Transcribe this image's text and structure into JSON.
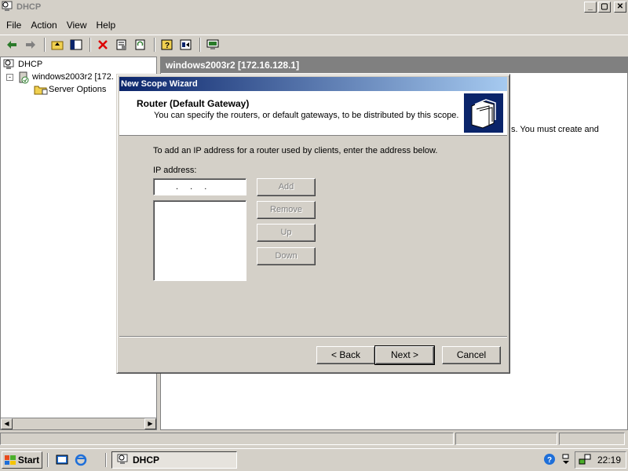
{
  "app": {
    "title": "DHCP",
    "min_btn": "_",
    "max_btn": "▢",
    "close_btn": "✕"
  },
  "menu": {
    "file": "File",
    "action": "Action",
    "view": "View",
    "help": "Help"
  },
  "toolbar": {
    "icons": [
      "back-arrow-icon",
      "forward-arrow-icon",
      "up-folder-icon",
      "show-hide-tree-icon",
      "delete-icon",
      "properties-icon",
      "refresh-icon",
      "help-icon",
      "export-list-icon",
      "display-icon"
    ]
  },
  "tree": {
    "root": "DHCP",
    "server": "windows2003r2 [172.",
    "server_options": "Server Options",
    "expander": "-"
  },
  "right_pane": {
    "header": "windows2003r2 [172.16.128.1]",
    "text_line": "s. You must create and"
  },
  "wizard": {
    "title": "New Scope Wizard",
    "header_title": "Router (Default Gateway)",
    "header_subtitle": "You can specify the routers, or default gateways, to be distributed by this scope.",
    "instructions": "To add an IP address for a router used by clients, enter the address below.",
    "ip_label": "IP address:",
    "ip_value": ". . .",
    "add_label": "Add",
    "remove_label": "Remove",
    "up_label": "Up",
    "down_label": "Down",
    "back_label": "< Back",
    "next_label": "Next >",
    "cancel_label": "Cancel"
  },
  "taskbar": {
    "start_label": "Start",
    "task_label": "DHCP",
    "clock": "22:19"
  },
  "colors": {
    "title_gradient_start": "#0a246a",
    "title_gradient_end": "#a6caf0",
    "pane_header": "#808080"
  }
}
